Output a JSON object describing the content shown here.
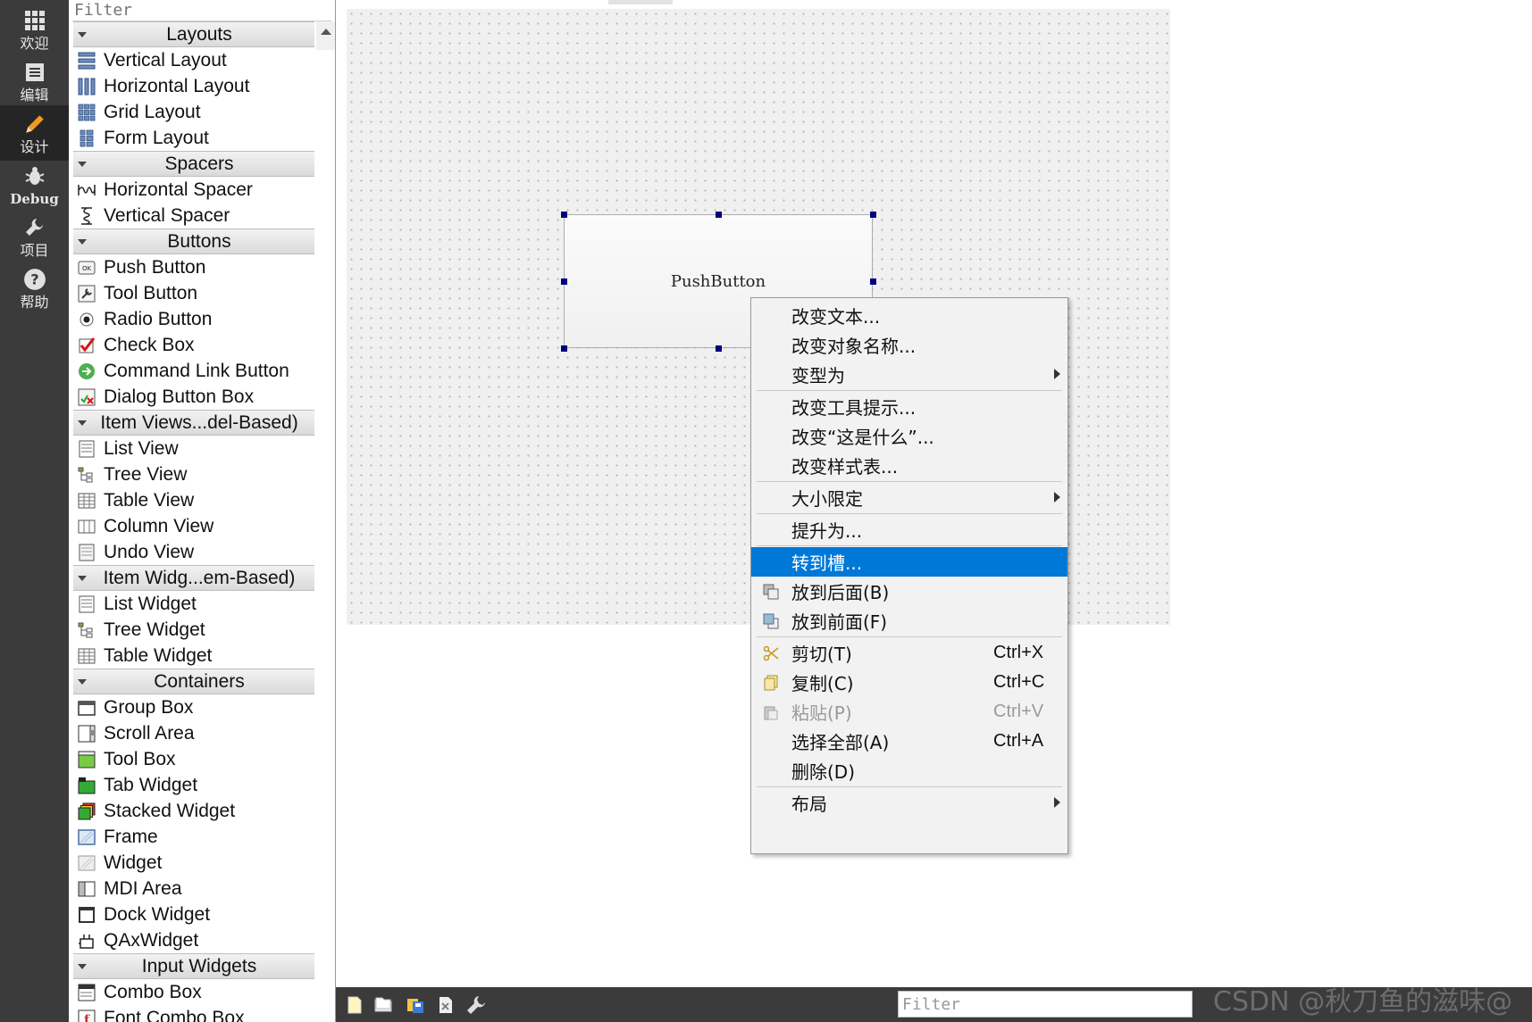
{
  "modebar": {
    "items": [
      {
        "label": "欢迎",
        "icon": "grid-icon"
      },
      {
        "label": "编辑",
        "icon": "document-icon"
      },
      {
        "label": "设计",
        "icon": "pencil-icon",
        "active": true
      },
      {
        "label": "Debug",
        "icon": "bug-icon"
      },
      {
        "label": "项目",
        "icon": "wrench-icon"
      },
      {
        "label": "帮助",
        "icon": "help-icon"
      }
    ]
  },
  "widgetbox": {
    "filter_placeholder": "Filter",
    "categories": [
      {
        "label": "Layouts",
        "items": [
          {
            "label": "Vertical Layout",
            "icon": "vertical-layout-icon"
          },
          {
            "label": "Horizontal Layout",
            "icon": "horizontal-layout-icon"
          },
          {
            "label": "Grid Layout",
            "icon": "grid-layout-icon"
          },
          {
            "label": "Form Layout",
            "icon": "form-layout-icon"
          }
        ]
      },
      {
        "label": "Spacers",
        "items": [
          {
            "label": "Horizontal Spacer",
            "icon": "horizontal-spacer-icon"
          },
          {
            "label": "Vertical Spacer",
            "icon": "vertical-spacer-icon"
          }
        ]
      },
      {
        "label": "Buttons",
        "items": [
          {
            "label": "Push Button",
            "icon": "push-button-icon"
          },
          {
            "label": "Tool Button",
            "icon": "tool-button-icon"
          },
          {
            "label": "Radio Button",
            "icon": "radio-button-icon"
          },
          {
            "label": "Check Box",
            "icon": "check-box-icon"
          },
          {
            "label": "Command Link Button",
            "icon": "command-link-icon"
          },
          {
            "label": "Dialog Button Box",
            "icon": "dialog-button-box-icon"
          }
        ]
      },
      {
        "label": "Item Views...del-Based)",
        "items": [
          {
            "label": "List View",
            "icon": "list-view-icon"
          },
          {
            "label": "Tree View",
            "icon": "tree-view-icon"
          },
          {
            "label": "Table View",
            "icon": "table-view-icon"
          },
          {
            "label": "Column View",
            "icon": "column-view-icon"
          },
          {
            "label": "Undo View",
            "icon": "undo-view-icon"
          }
        ]
      },
      {
        "label": "Item Widg...em-Based)",
        "items": [
          {
            "label": "List Widget",
            "icon": "list-widget-icon"
          },
          {
            "label": "Tree Widget",
            "icon": "tree-widget-icon"
          },
          {
            "label": "Table Widget",
            "icon": "table-widget-icon"
          }
        ]
      },
      {
        "label": "Containers",
        "items": [
          {
            "label": "Group Box",
            "icon": "group-box-icon"
          },
          {
            "label": "Scroll Area",
            "icon": "scroll-area-icon"
          },
          {
            "label": "Tool Box",
            "icon": "tool-box-icon"
          },
          {
            "label": "Tab Widget",
            "icon": "tab-widget-icon"
          },
          {
            "label": "Stacked Widget",
            "icon": "stacked-widget-icon"
          },
          {
            "label": "Frame",
            "icon": "frame-icon"
          },
          {
            "label": "Widget",
            "icon": "widget-icon"
          },
          {
            "label": "MDI Area",
            "icon": "mdi-area-icon"
          },
          {
            "label": "Dock Widget",
            "icon": "dock-widget-icon"
          },
          {
            "label": "QAxWidget",
            "icon": "qaxwidget-icon"
          }
        ]
      },
      {
        "label": "Input Widgets",
        "items": [
          {
            "label": "Combo Box",
            "icon": "combo-box-icon"
          },
          {
            "label": "Font Combo Box",
            "icon": "font-combo-box-icon"
          }
        ]
      }
    ]
  },
  "form": {
    "pushbutton_text": "PushButton"
  },
  "context_menu": {
    "items": [
      {
        "label": "改变文本..."
      },
      {
        "label": "改变对象名称..."
      },
      {
        "label": "变型为",
        "submenu": true
      },
      {
        "separator": true
      },
      {
        "label": "改变工具提示..."
      },
      {
        "label": "改变“这是什么”..."
      },
      {
        "label": "改变样式表..."
      },
      {
        "separator": true
      },
      {
        "label": "大小限定",
        "submenu": true
      },
      {
        "separator": true
      },
      {
        "label": "提升为..."
      },
      {
        "separator": true
      },
      {
        "label": "转到槽...",
        "highlighted": true
      },
      {
        "label": "放到后面(B)",
        "icon": "send-to-back-icon"
      },
      {
        "label": "放到前面(F)",
        "icon": "bring-to-front-icon"
      },
      {
        "separator": true
      },
      {
        "label": "剪切(T)",
        "icon": "cut-icon",
        "shortcut": "Ctrl+X"
      },
      {
        "label": "复制(C)",
        "icon": "copy-icon",
        "shortcut": "Ctrl+C"
      },
      {
        "label": "粘贴(P)",
        "icon": "paste-icon",
        "shortcut": "Ctrl+V",
        "disabled": true
      },
      {
        "label": "选择全部(A)",
        "shortcut": "Ctrl+A"
      },
      {
        "label": "删除(D)"
      },
      {
        "separator": true
      },
      {
        "label": "布局",
        "submenu": true
      }
    ]
  },
  "bottombar": {
    "icons": [
      "new-file-icon",
      "open-file-icon",
      "save-icon",
      "close-icon",
      "tools-icon"
    ],
    "filter_placeholder": "Filter"
  },
  "watermark": "CSDN @秋刀鱼的滋味@",
  "colors": {
    "modebar_bg": "#3b3b3b",
    "menu_highlight": "#0078d7",
    "handle": "#000080",
    "canvas_bg": "#f0f0f0"
  }
}
